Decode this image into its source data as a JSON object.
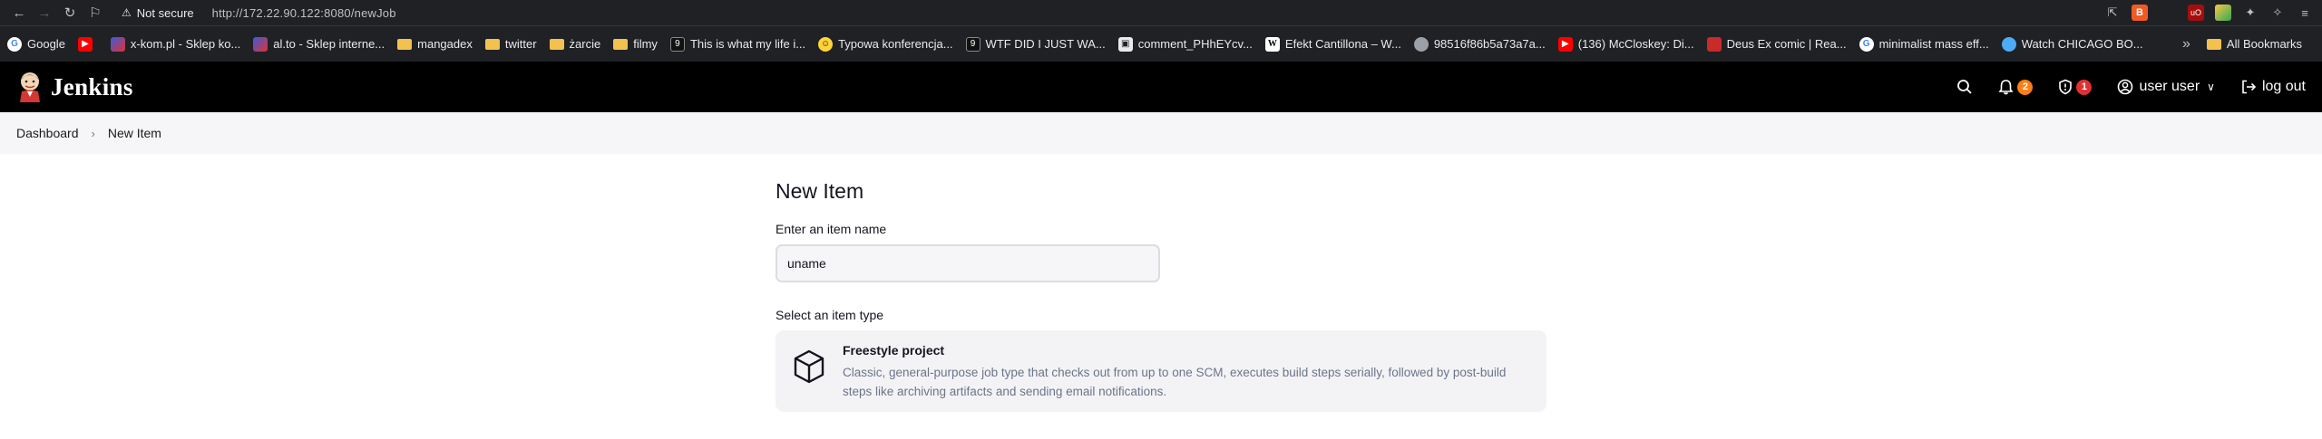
{
  "browser": {
    "security_label": "Not secure",
    "url": "http://172.22.90.122:8080/newJob",
    "bookmarks": [
      {
        "label": "Google",
        "icon": "google-icon"
      },
      {
        "label": "",
        "icon": "youtube-icon"
      },
      {
        "label": "x-kom.pl - Sklep ko...",
        "icon": "xkom-icon"
      },
      {
        "label": "al.to - Sklep interne...",
        "icon": "alto-icon"
      },
      {
        "label": "mangadex",
        "icon": "folder-icon"
      },
      {
        "label": "twitter",
        "icon": "folder-icon"
      },
      {
        "label": "żarcie",
        "icon": "folder-icon"
      },
      {
        "label": "filmy",
        "icon": "folder-icon"
      },
      {
        "label": "This is what my life i...",
        "icon": "site-icon"
      },
      {
        "label": "Typowa konferencja...",
        "icon": "emoji-icon"
      },
      {
        "label": "WTF DID I JUST WA...",
        "icon": "site-icon"
      },
      {
        "label": "comment_PHhEYcv...",
        "icon": "doc-icon"
      },
      {
        "label": "Efekt Cantillona – W...",
        "icon": "wikipedia-icon"
      },
      {
        "label": "98516f86b5a73a7a...",
        "icon": "globe-icon"
      },
      {
        "label": "(136) McCloskey: Di...",
        "icon": "youtube-icon"
      },
      {
        "label": "Deus Ex comic | Rea...",
        "icon": "shield-icon"
      },
      {
        "label": "minimalist mass eff...",
        "icon": "google-icon"
      },
      {
        "label": "Watch CHICAGO BO...",
        "icon": "globe-icon"
      }
    ],
    "overflow_label": "»",
    "all_bookmarks_label": "All Bookmarks"
  },
  "header": {
    "brand": "Jenkins",
    "notifications_count": "2",
    "security_count": "1",
    "user_label": "user user",
    "logout_label": "log out"
  },
  "breadcrumb": {
    "items": [
      "Dashboard",
      "New Item"
    ]
  },
  "main": {
    "title": "New Item",
    "name_label": "Enter an item name",
    "name_value": "uname",
    "type_label": "Select an item type",
    "item_types": [
      {
        "title": "Freestyle project",
        "description": "Classic, general-purpose job type that checks out from up to one SCM, executes build steps serially, followed by post-build steps like archiving artifacts and sending email notifications."
      }
    ]
  }
}
